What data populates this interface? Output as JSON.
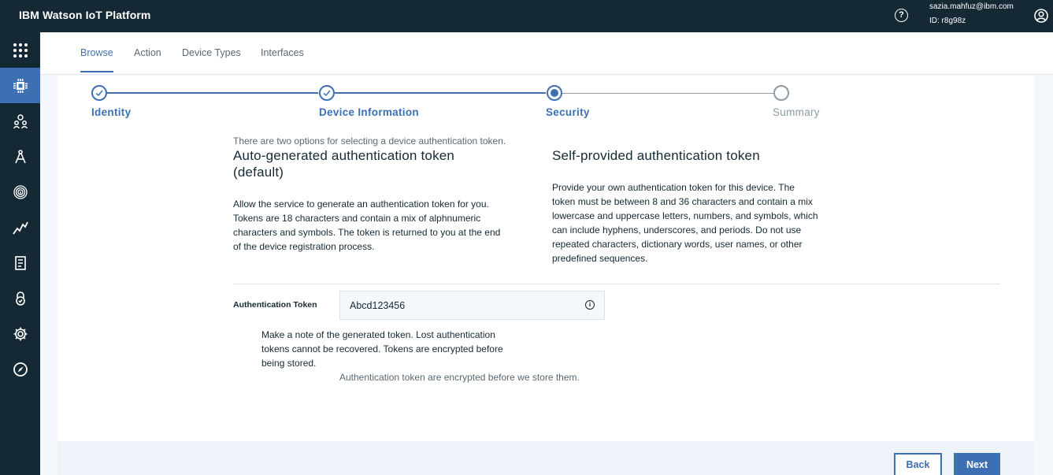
{
  "header": {
    "title": "IBM Watson IoT Platform",
    "help_icon": "?",
    "user_email": "sazia.mahfuz@ibm.com",
    "user_id": "ID: r8g98z"
  },
  "sidenav": {
    "items": [
      {
        "icon": "apps-grid-icon",
        "active": false
      },
      {
        "icon": "devices-chip-icon",
        "active": true
      },
      {
        "icon": "members-icon",
        "active": false
      },
      {
        "icon": "rules-compass-icon",
        "active": false
      },
      {
        "icon": "fingerprint-icon",
        "active": false
      },
      {
        "icon": "usage-chart-icon",
        "active": false
      },
      {
        "icon": "logs-document-icon",
        "active": false
      },
      {
        "icon": "security-lock-icon",
        "active": false
      },
      {
        "icon": "settings-gear-icon",
        "active": false
      },
      {
        "icon": "explore-compass-icon",
        "active": false
      }
    ]
  },
  "tabs": [
    "Browse",
    "Action",
    "Device Types",
    "Interfaces"
  ],
  "active_tab": "Browse",
  "stepper": {
    "steps": [
      "Identity",
      "Device Information",
      "Security",
      "Summary"
    ],
    "current_step": "Security"
  },
  "content": {
    "intro": "There are two options for selecting a device authentication token.",
    "auto": {
      "title_line1": "Auto-generated authentication token",
      "title_line2": "(default)",
      "desc_lines": [
        "Allow the service to generate an authentication token for you.",
        "Tokens are 18 characters and contain a mix of alphnumeric",
        "characters and symbols. The token is returned to you at the end",
        "of the device registration process."
      ]
    },
    "self": {
      "title": "Self-provided authentication token",
      "desc_lines": [
        "Provide your own authentication token for this device. The",
        "token must be between 8 and 36 characters and contain a mix",
        "lowercase and uppercase letters, numbers, and symbols, which",
        "can include hyphens, underscores, and periods. Do not use",
        "repeated characters, dictionary words, user names, or other",
        "predefined sequences."
      ]
    },
    "token_label": "Authentication Token",
    "token_value": "Abcd123456",
    "note_lines": [
      "Make a note of the generated token. Lost authentication",
      "tokens cannot be recovered. Tokens are encrypted before",
      "being stored."
    ],
    "helper": "Authentication token are encrypted before we store them."
  },
  "footer": {
    "back_label": "Back",
    "next_label": "Next"
  },
  "colors": {
    "header_bg": "#152935",
    "accent": "#3d70b2",
    "inactive_step": "#8c9ba5"
  }
}
